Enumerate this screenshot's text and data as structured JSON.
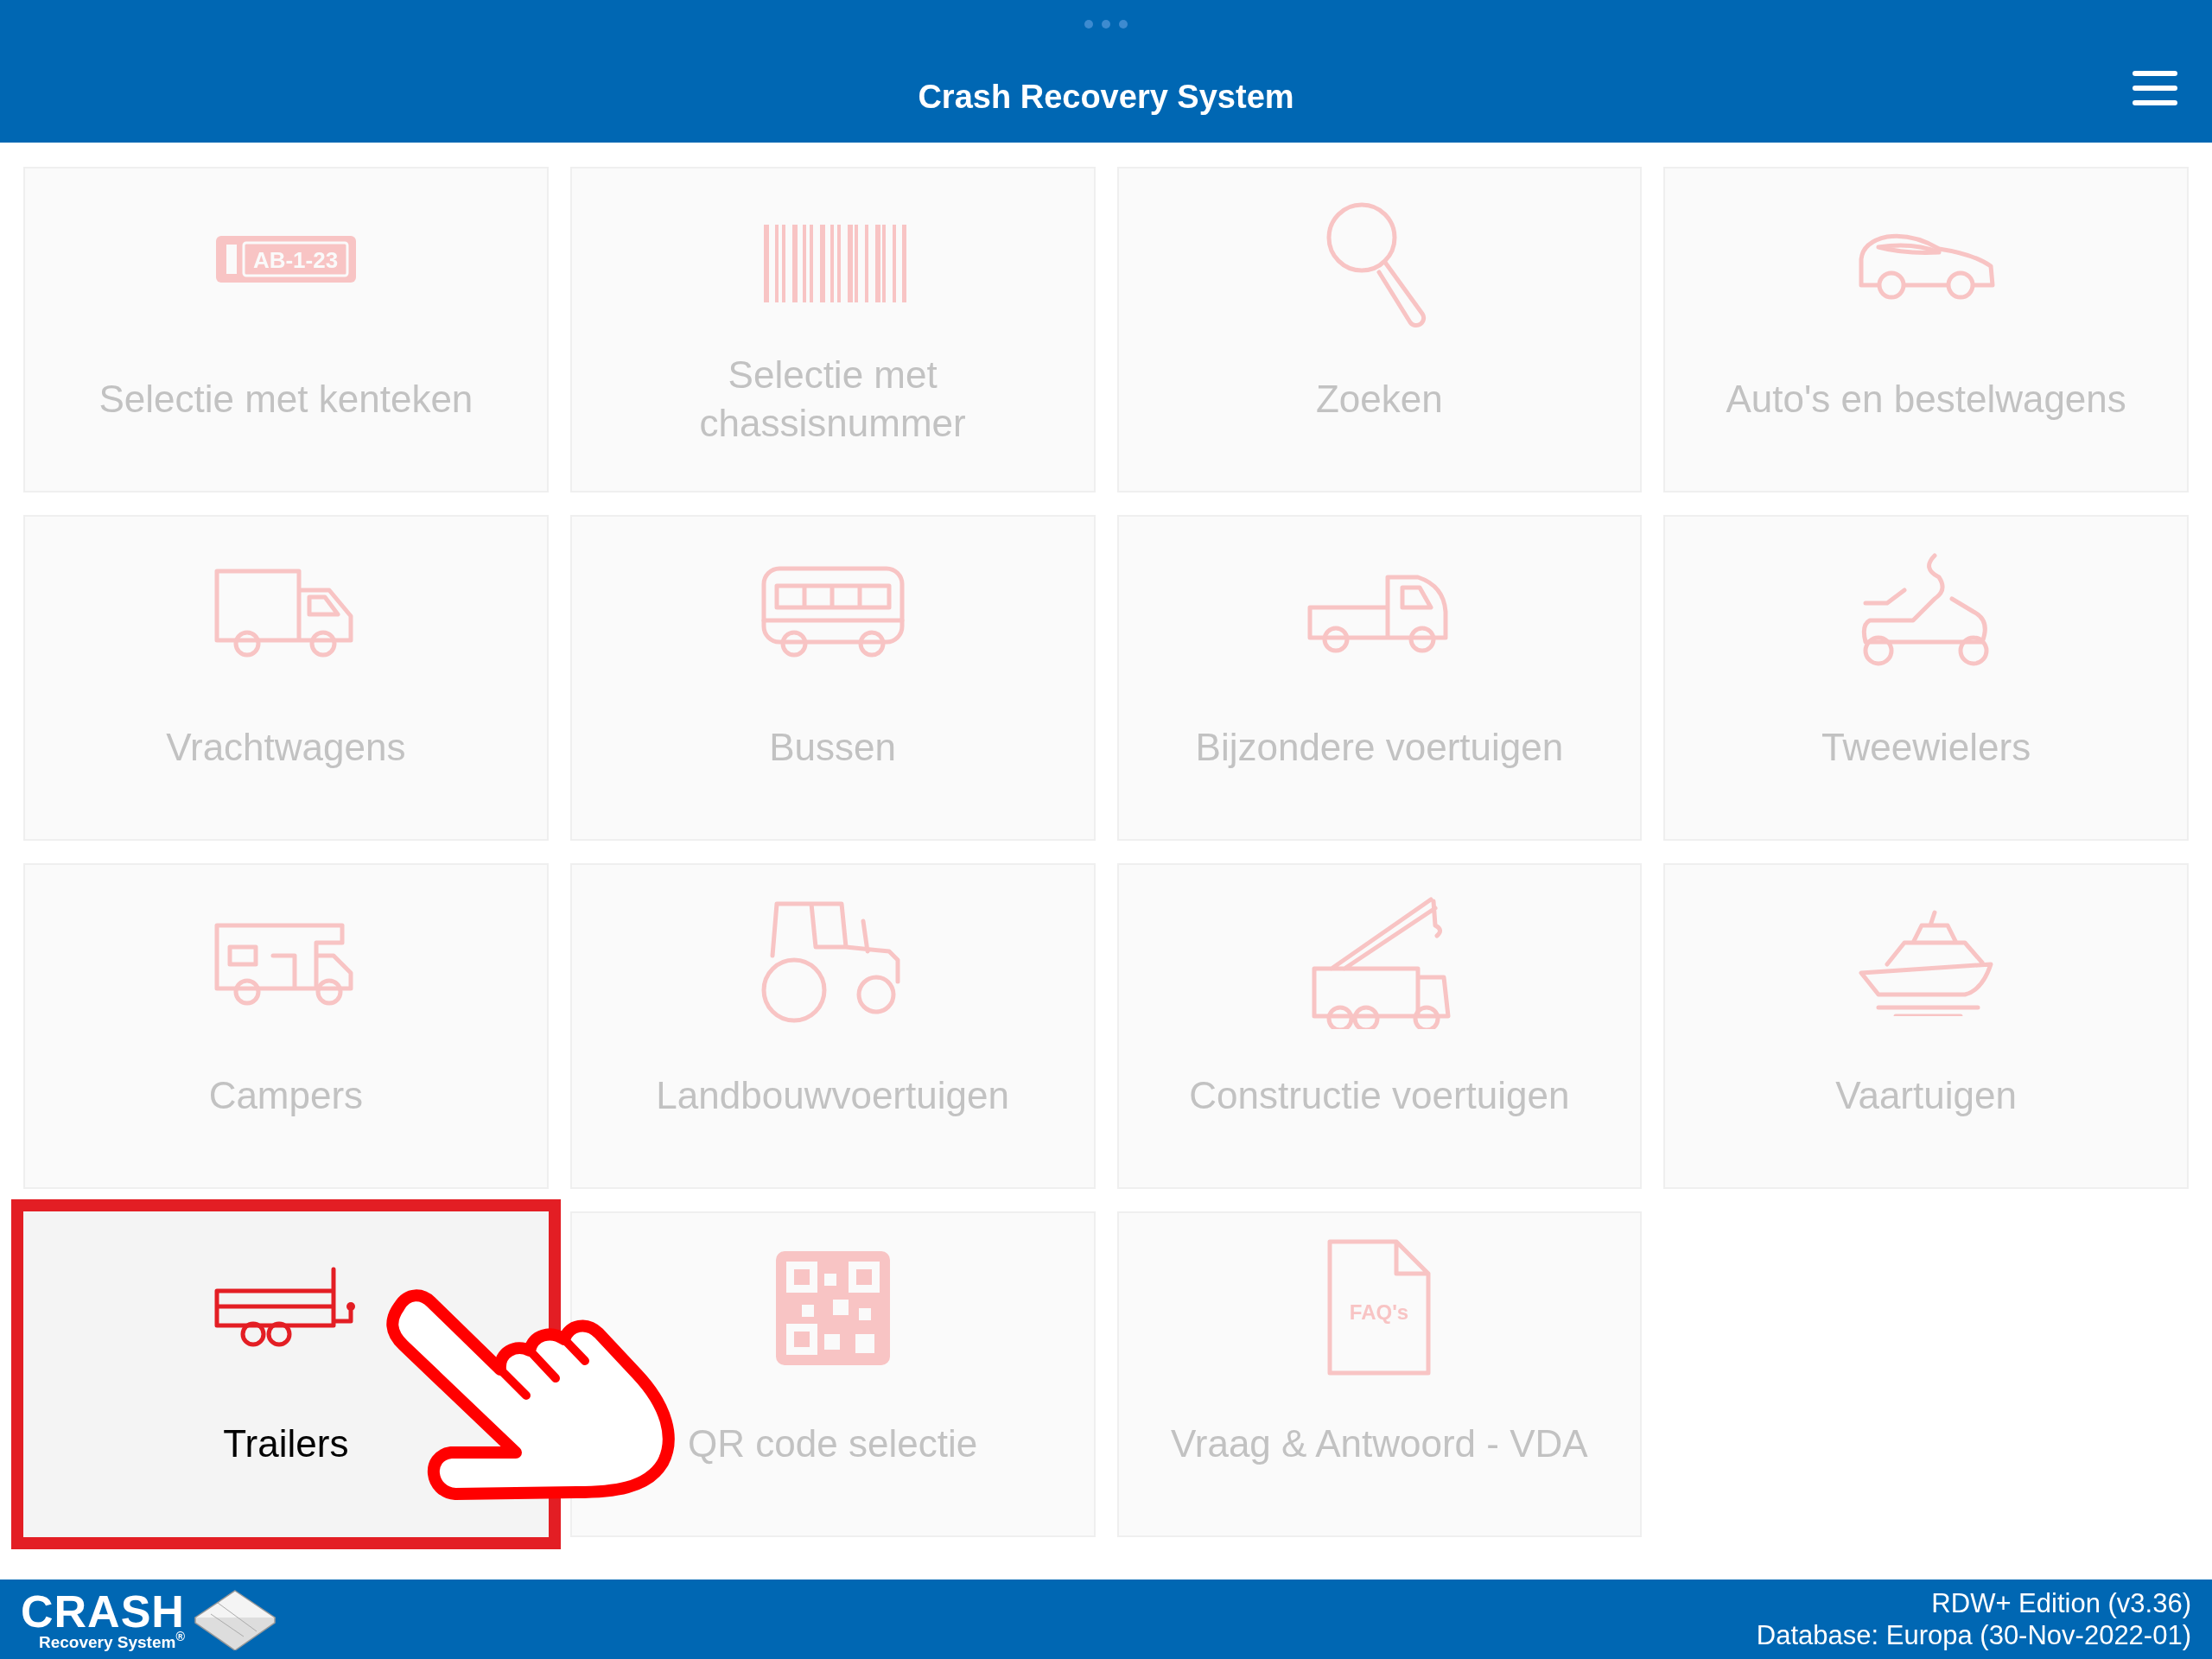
{
  "header": {
    "title": "Crash Recovery System"
  },
  "tiles": [
    {
      "label": "Selectie met kenteken",
      "icon_text": "AB-1-23",
      "selected": false
    },
    {
      "label": "Selectie met chassisnummer",
      "selected": false
    },
    {
      "label": "Zoeken",
      "selected": false
    },
    {
      "label": "Auto's en bestelwagens",
      "selected": false
    },
    {
      "label": "Vrachtwagens",
      "selected": false
    },
    {
      "label": "Bussen",
      "selected": false
    },
    {
      "label": "Bijzondere voertuigen",
      "selected": false
    },
    {
      "label": "Tweewielers",
      "selected": false
    },
    {
      "label": "Campers",
      "selected": false
    },
    {
      "label": "Landbouwvoertuigen",
      "selected": false
    },
    {
      "label": "Constructie voertuigen",
      "selected": false
    },
    {
      "label": "Vaartuigen",
      "selected": false
    },
    {
      "label": "Trailers",
      "selected": true
    },
    {
      "label": "QR code selectie",
      "selected": false
    },
    {
      "label": "Vraag & Antwoord - VDA",
      "icon_text": "FAQ's",
      "selected": false
    }
  ],
  "footer": {
    "logo_title": "CRASH",
    "logo_subtitle": "Recovery System$^{®}$",
    "edition": "RDW+ Edition (v3.36)",
    "database": "Database: Europa (30-Nov-2022-01)"
  }
}
